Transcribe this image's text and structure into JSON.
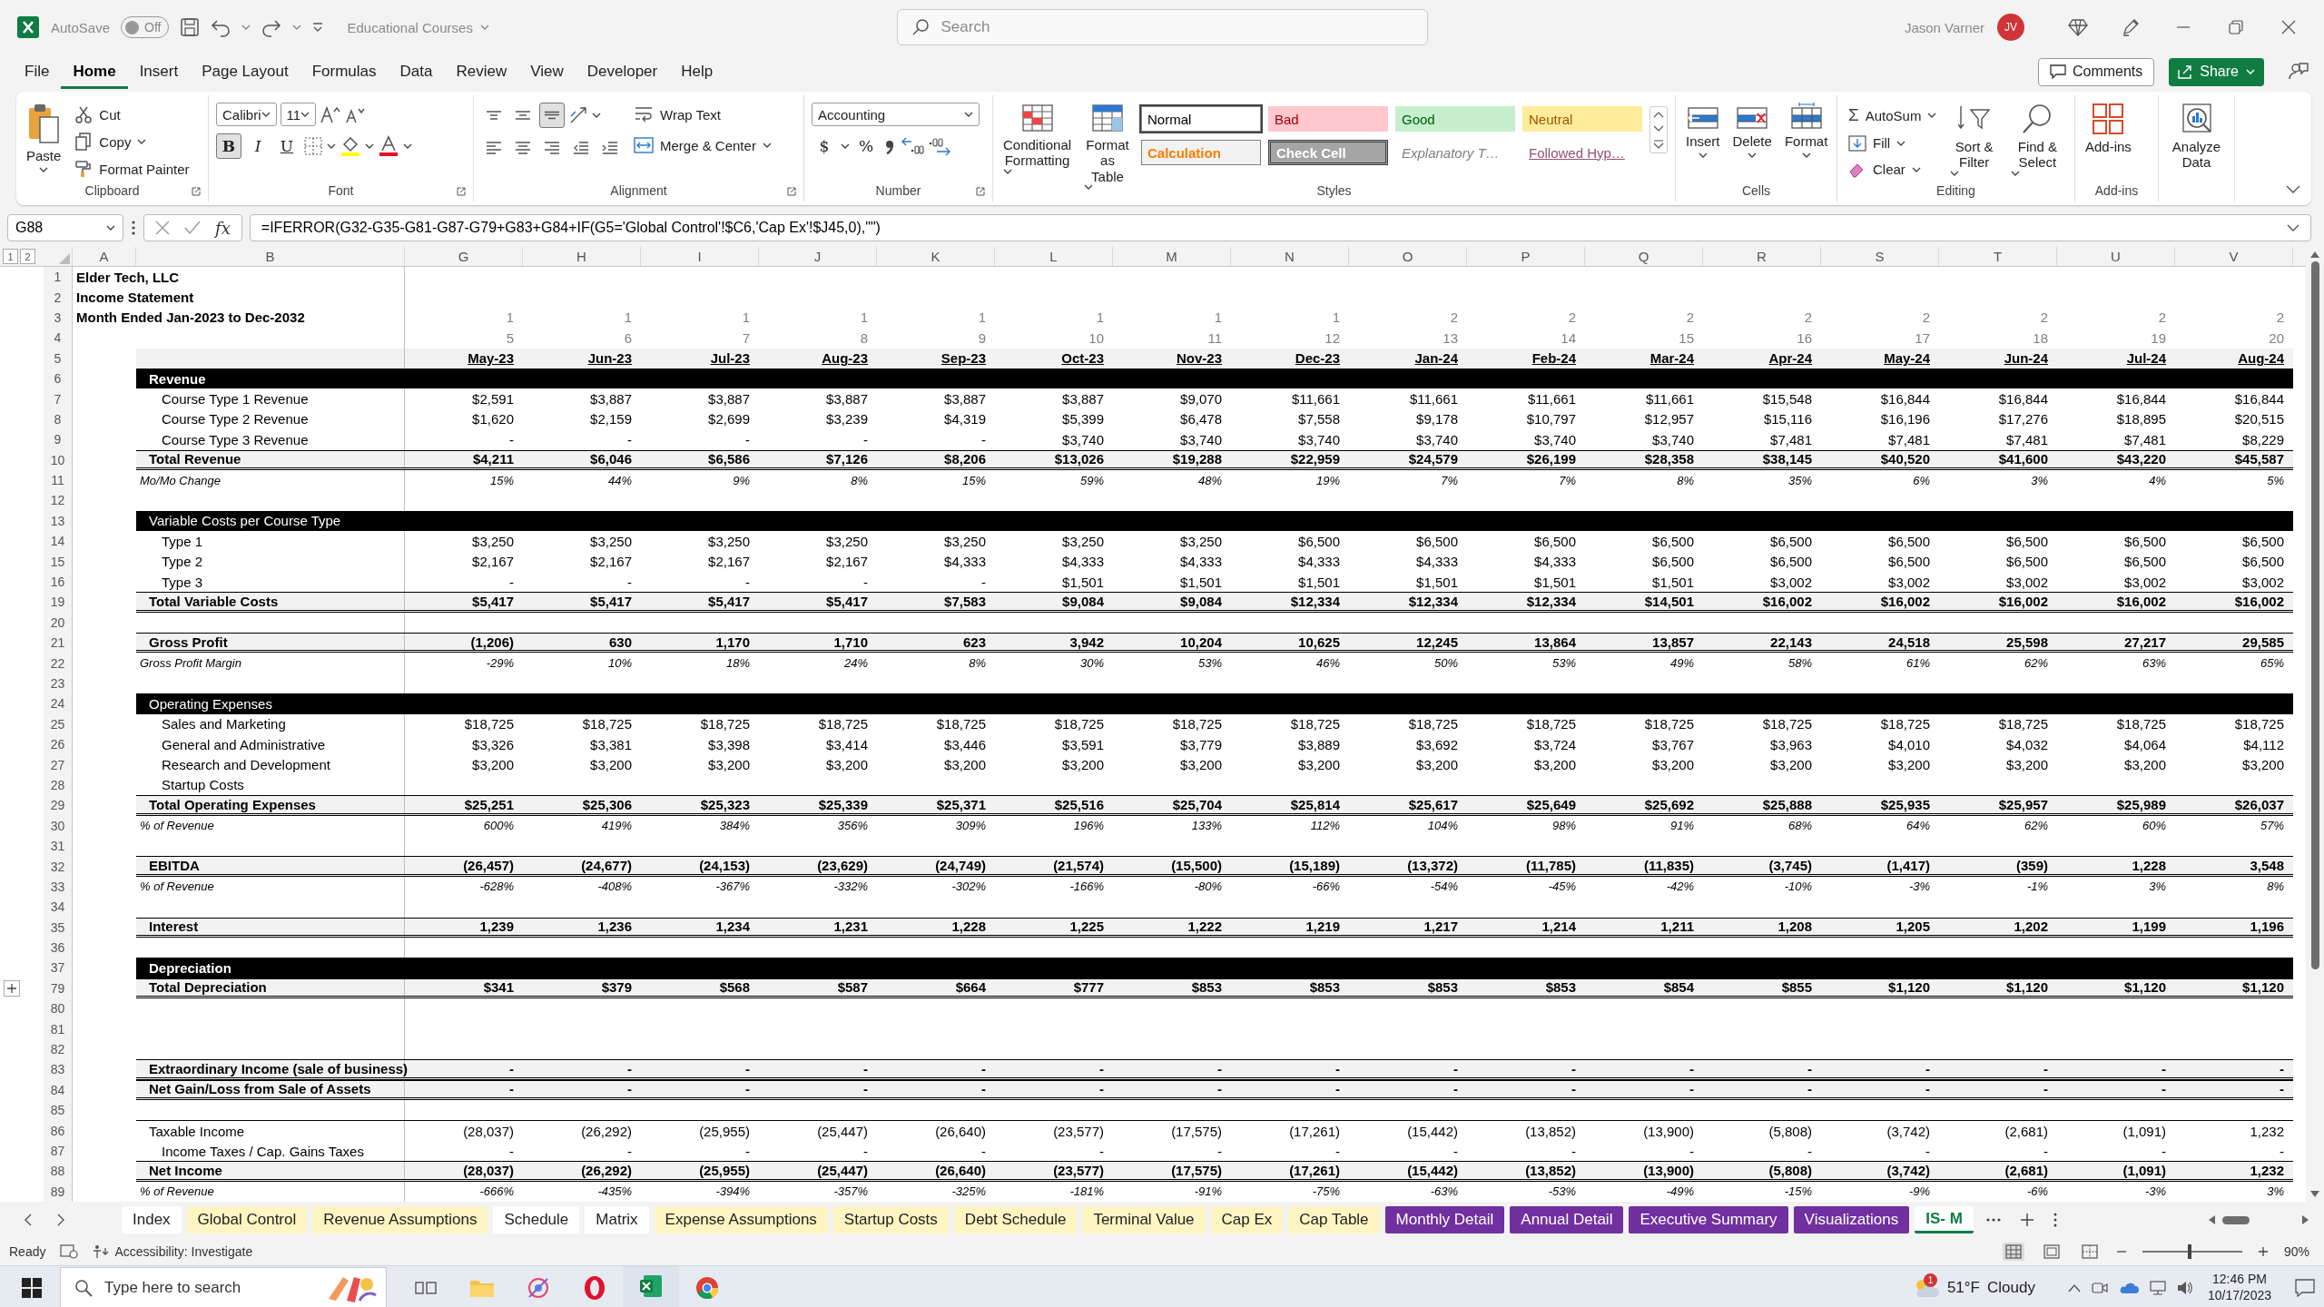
{
  "title_bar": {
    "autosave_label": "AutoSave",
    "autosave": {
      "on": false,
      "label": "Off"
    },
    "document": "Educational Courses",
    "search_placeholder": "Search",
    "user": "Jason Varner",
    "avatar": "JV"
  },
  "menu_tabs": [
    {
      "label": "File",
      "selected": false
    },
    {
      "label": "Home",
      "selected": true
    },
    {
      "label": "Insert",
      "selected": false
    },
    {
      "label": "Page Layout",
      "selected": false
    },
    {
      "label": "Formulas",
      "selected": false
    },
    {
      "label": "Data",
      "selected": false
    },
    {
      "label": "Review",
      "selected": false
    },
    {
      "label": "View",
      "selected": false
    },
    {
      "label": "Developer",
      "selected": false
    },
    {
      "label": "Help",
      "selected": false
    }
  ],
  "comments": "Comments",
  "share": "Share",
  "ribbon": {
    "clipboard": {
      "title": "Clipboard",
      "paste": "Paste",
      "cut": "Cut",
      "copy": "Copy",
      "format_painter": "Format Painter"
    },
    "font": {
      "title": "Font",
      "font": "Calibri",
      "size": "11",
      "styles": [
        {
          "label": "B",
          "selected": true
        },
        {
          "label": "I",
          "selected": false
        },
        {
          "label": "U",
          "selected": false
        }
      ]
    },
    "alignment": {
      "title": "Alignment",
      "vertical": [
        {
          "selected": false
        },
        {
          "selected": false
        },
        {
          "selected": true
        }
      ],
      "wrap": "Wrap Text",
      "merge": "Merge & Center"
    },
    "number": {
      "title": "Number",
      "format": "Accounting",
      "currency": "$",
      "percent": "%"
    },
    "styles": {
      "title": "Styles",
      "conditional": "Conditional Formatting",
      "table": "Format as Table",
      "cells": [
        {
          "label": "Normal",
          "kind": "normal",
          "selected": true
        },
        {
          "label": "Bad",
          "kind": "bad",
          "selected": false
        },
        {
          "label": "Good",
          "kind": "good",
          "selected": false
        },
        {
          "label": "Neutral",
          "kind": "neutral",
          "selected": false
        },
        {
          "label": "Calculation",
          "kind": "calculation",
          "selected": false
        },
        {
          "label": "Check Cell",
          "kind": "check",
          "selected": false
        },
        {
          "label": "Explanatory T…",
          "kind": "explanatory",
          "selected": false
        },
        {
          "label": "Followed Hyp…",
          "kind": "hyperlink",
          "selected": false
        }
      ]
    },
    "cells": {
      "title": "Cells",
      "buttons": [
        "Insert",
        "Delete",
        "Format"
      ]
    },
    "editing": {
      "title": "Editing",
      "autosum_symbol": "Σ",
      "autosum": "AutoSum",
      "fill": "Fill",
      "clear": "Clear",
      "sort": "Sort & Filter",
      "find": "Find & Select"
    },
    "addins": {
      "title": "Add-ins",
      "button": "Add-ins"
    },
    "analyze": {
      "button": "Analyze Data"
    }
  },
  "formula_bar": {
    "name_box": "G88",
    "fx": "fx",
    "formula": "=IFERROR(G32-G35-G81-G87-G79+G83+G84+IF(G5='Global Control'!$C6,'Cap Ex'!$J45,0),\"\")"
  },
  "sheet": {
    "outline_levels": [
      "1",
      "2"
    ],
    "columns": [
      "A",
      "B",
      "G",
      "H",
      "I",
      "J",
      "K",
      "L",
      "M",
      "N",
      "O",
      "P",
      "Q",
      "R",
      "S",
      "T",
      "U",
      "V"
    ],
    "rows": [
      {
        "n": "1",
        "kind": "title",
        "collapsed": false,
        "label": "Elder Tech, LLC"
      },
      {
        "n": "2",
        "kind": "title",
        "collapsed": false,
        "label": "Income Statement"
      },
      {
        "n": "3",
        "kind": "title",
        "collapsed": false,
        "label": "Month Ended Jan-2023 to Dec-2032",
        "values": [
          "1",
          "1",
          "1",
          "1",
          "1",
          "1",
          "1",
          "1",
          "2",
          "2",
          "2",
          "2",
          "2",
          "2",
          "2",
          "2"
        ]
      },
      {
        "n": "4",
        "kind": "index",
        "collapsed": false,
        "values": [
          "5",
          "6",
          "7",
          "8",
          "9",
          "10",
          "11",
          "12",
          "13",
          "14",
          "15",
          "16",
          "17",
          "18",
          "19",
          "20"
        ]
      },
      {
        "n": "5",
        "kind": "months",
        "collapsed": false,
        "values": [
          "May-23",
          "Jun-23",
          "Jul-23",
          "Aug-23",
          "Sep-23",
          "Oct-23",
          "Nov-23",
          "Dec-23",
          "Jan-24",
          "Feb-24",
          "Mar-24",
          "Apr-24",
          "May-24",
          "Jun-24",
          "Jul-24",
          "Aug-24"
        ]
      },
      {
        "n": "6",
        "kind": "section",
        "collapsed": false,
        "label": "Revenue"
      },
      {
        "n": "7",
        "kind": "item",
        "collapsed": false,
        "label": "Course Type 1 Revenue",
        "values": [
          "$2,591",
          "$3,887",
          "$3,887",
          "$3,887",
          "$3,887",
          "$3,887",
          "$9,070",
          "$11,661",
          "$11,661",
          "$11,661",
          "$11,661",
          "$15,548",
          "$16,844",
          "$16,844",
          "$16,844",
          "$16,844"
        ]
      },
      {
        "n": "8",
        "kind": "item",
        "collapsed": false,
        "label": "Course Type 2 Revenue",
        "values": [
          "$1,620",
          "$2,159",
          "$2,699",
          "$3,239",
          "$4,319",
          "$5,399",
          "$6,478",
          "$7,558",
          "$9,178",
          "$10,797",
          "$12,957",
          "$15,116",
          "$16,196",
          "$17,276",
          "$18,895",
          "$20,515"
        ]
      },
      {
        "n": "9",
        "kind": "item",
        "collapsed": false,
        "label": "Course Type 3 Revenue",
        "values": [
          "-",
          "-",
          "-",
          "-",
          "-",
          "$3,740",
          "$3,740",
          "$3,740",
          "$3,740",
          "$3,740",
          "$3,740",
          "$7,481",
          "$7,481",
          "$7,481",
          "$7,481",
          "$8,229"
        ]
      },
      {
        "n": "10",
        "kind": "total",
        "collapsed": false,
        "label": "Total Revenue",
        "values": [
          "$4,211",
          "$6,046",
          "$6,586",
          "$7,126",
          "$8,206",
          "$13,026",
          "$19,288",
          "$22,959",
          "$24,579",
          "$26,199",
          "$28,358",
          "$38,145",
          "$40,520",
          "$41,600",
          "$43,220",
          "$45,587"
        ]
      },
      {
        "n": "11",
        "kind": "ratio",
        "collapsed": false,
        "label": "Mo/Mo Change",
        "values": [
          "15%",
          "44%",
          "9%",
          "8%",
          "15%",
          "59%",
          "48%",
          "19%",
          "7%",
          "7%",
          "8%",
          "35%",
          "6%",
          "3%",
          "4%",
          "5%"
        ]
      },
      {
        "n": "12",
        "kind": "blank",
        "collapsed": false
      },
      {
        "n": "13",
        "kind": "group",
        "collapsed": false,
        "label": "Variable Costs per Course Type"
      },
      {
        "n": "14",
        "kind": "item",
        "collapsed": false,
        "label": "Type 1",
        "values": [
          "$3,250",
          "$3,250",
          "$3,250",
          "$3,250",
          "$3,250",
          "$3,250",
          "$3,250",
          "$6,500",
          "$6,500",
          "$6,500",
          "$6,500",
          "$6,500",
          "$6,500",
          "$6,500",
          "$6,500",
          "$6,500"
        ]
      },
      {
        "n": "15",
        "kind": "item",
        "collapsed": false,
        "label": "Type 2",
        "values": [
          "$2,167",
          "$2,167",
          "$2,167",
          "$2,167",
          "$4,333",
          "$4,333",
          "$4,333",
          "$4,333",
          "$4,333",
          "$4,333",
          "$6,500",
          "$6,500",
          "$6,500",
          "$6,500",
          "$6,500",
          "$6,500"
        ]
      },
      {
        "n": "16",
        "kind": "item",
        "collapsed": false,
        "label": "Type 3",
        "values": [
          "-",
          "-",
          "-",
          "-",
          "-",
          "$1,501",
          "$1,501",
          "$1,501",
          "$1,501",
          "$1,501",
          "$1,501",
          "$3,002",
          "$3,002",
          "$3,002",
          "$3,002",
          "$3,002"
        ]
      },
      {
        "n": "19",
        "kind": "total",
        "collapsed": false,
        "label": "Total Variable Costs",
        "values": [
          "$5,417",
          "$5,417",
          "$5,417",
          "$5,417",
          "$7,583",
          "$9,084",
          "$9,084",
          "$12,334",
          "$12,334",
          "$12,334",
          "$14,501",
          "$16,002",
          "$16,002",
          "$16,002",
          "$16,002",
          "$16,002"
        ]
      },
      {
        "n": "20",
        "kind": "blank",
        "collapsed": false
      },
      {
        "n": "21",
        "kind": "total",
        "collapsed": false,
        "label": "Gross Profit",
        "values": [
          "(1,206)",
          "630",
          "1,170",
          "1,710",
          "623",
          "3,942",
          "10,204",
          "10,625",
          "12,245",
          "13,864",
          "13,857",
          "22,143",
          "24,518",
          "25,598",
          "27,217",
          "29,585"
        ]
      },
      {
        "n": "22",
        "kind": "ratio",
        "collapsed": false,
        "label": "Gross Profit Margin",
        "values": [
          "-29%",
          "10%",
          "18%",
          "24%",
          "8%",
          "30%",
          "53%",
          "46%",
          "50%",
          "53%",
          "49%",
          "58%",
          "61%",
          "62%",
          "63%",
          "65%"
        ]
      },
      {
        "n": "23",
        "kind": "blank",
        "collapsed": false
      },
      {
        "n": "24",
        "kind": "group",
        "collapsed": false,
        "label": "Operating Expenses"
      },
      {
        "n": "25",
        "kind": "item",
        "collapsed": false,
        "label": "Sales and Marketing",
        "values": [
          "$18,725",
          "$18,725",
          "$18,725",
          "$18,725",
          "$18,725",
          "$18,725",
          "$18,725",
          "$18,725",
          "$18,725",
          "$18,725",
          "$18,725",
          "$18,725",
          "$18,725",
          "$18,725",
          "$18,725",
          "$18,725"
        ]
      },
      {
        "n": "26",
        "kind": "item",
        "collapsed": false,
        "label": "General and Administrative",
        "values": [
          "$3,326",
          "$3,381",
          "$3,398",
          "$3,414",
          "$3,446",
          "$3,591",
          "$3,779",
          "$3,889",
          "$3,692",
          "$3,724",
          "$3,767",
          "$3,963",
          "$4,010",
          "$4,032",
          "$4,064",
          "$4,112"
        ]
      },
      {
        "n": "27",
        "kind": "item",
        "collapsed": false,
        "label": "Research and Development",
        "values": [
          "$3,200",
          "$3,200",
          "$3,200",
          "$3,200",
          "$3,200",
          "$3,200",
          "$3,200",
          "$3,200",
          "$3,200",
          "$3,200",
          "$3,200",
          "$3,200",
          "$3,200",
          "$3,200",
          "$3,200",
          "$3,200"
        ]
      },
      {
        "n": "28",
        "kind": "item",
        "collapsed": false,
        "label": "Startup Costs"
      },
      {
        "n": "29",
        "kind": "total",
        "collapsed": false,
        "label": "Total Operating Expenses",
        "values": [
          "$25,251",
          "$25,306",
          "$25,323",
          "$25,339",
          "$25,371",
          "$25,516",
          "$25,704",
          "$25,814",
          "$25,617",
          "$25,649",
          "$25,692",
          "$25,888",
          "$25,935",
          "$25,957",
          "$25,989",
          "$26,037"
        ]
      },
      {
        "n": "30",
        "kind": "ratio",
        "collapsed": false,
        "label": "% of Revenue",
        "values": [
          "600%",
          "419%",
          "384%",
          "356%",
          "309%",
          "196%",
          "133%",
          "112%",
          "104%",
          "98%",
          "91%",
          "68%",
          "64%",
          "62%",
          "60%",
          "57%"
        ]
      },
      {
        "n": "31",
        "kind": "blank",
        "collapsed": false
      },
      {
        "n": "32",
        "kind": "total",
        "collapsed": false,
        "label": "EBITDA",
        "values": [
          "(26,457)",
          "(24,677)",
          "(24,153)",
          "(23,629)",
          "(24,749)",
          "(21,574)",
          "(15,500)",
          "(15,189)",
          "(13,372)",
          "(11,785)",
          "(11,835)",
          "(3,745)",
          "(1,417)",
          "(359)",
          "1,228",
          "3,548"
        ]
      },
      {
        "n": "33",
        "kind": "ratio",
        "collapsed": false,
        "label": "% of Revenue",
        "values": [
          "-628%",
          "-408%",
          "-367%",
          "-332%",
          "-302%",
          "-166%",
          "-80%",
          "-66%",
          "-54%",
          "-45%",
          "-42%",
          "-10%",
          "-3%",
          "-1%",
          "3%",
          "8%"
        ]
      },
      {
        "n": "34",
        "kind": "blank",
        "collapsed": false
      },
      {
        "n": "35",
        "kind": "total",
        "collapsed": false,
        "label": "Interest",
        "values": [
          "1,239",
          "1,236",
          "1,234",
          "1,231",
          "1,228",
          "1,225",
          "1,222",
          "1,219",
          "1,217",
          "1,214",
          "1,211",
          "1,208",
          "1,205",
          "1,202",
          "1,199",
          "1,196"
        ]
      },
      {
        "n": "36",
        "kind": "blank",
        "collapsed": false
      },
      {
        "n": "37",
        "kind": "section",
        "collapsed": false,
        "label": "Depreciation"
      },
      {
        "n": "79",
        "kind": "total",
        "collapsed": true,
        "label": "Total Depreciation",
        "values": [
          "$341",
          "$379",
          "$568",
          "$587",
          "$664",
          "$777",
          "$853",
          "$853",
          "$853",
          "$853",
          "$854",
          "$855",
          "$1,120",
          "$1,120",
          "$1,120",
          "$1,120"
        ]
      },
      {
        "n": "80",
        "kind": "blank",
        "collapsed": false
      },
      {
        "n": "81",
        "kind": "blank",
        "collapsed": false
      },
      {
        "n": "82",
        "kind": "blank",
        "collapsed": false
      },
      {
        "n": "83",
        "kind": "total",
        "collapsed": false,
        "label": "Extraordinary Income (sale of business)",
        "values": [
          "-",
          "-",
          "-",
          "-",
          "-",
          "-",
          "-",
          "-",
          "-",
          "-",
          "-",
          "-",
          "-",
          "-",
          "-",
          "-"
        ]
      },
      {
        "n": "84",
        "kind": "total",
        "collapsed": false,
        "label": "Net Gain/Loss from Sale of Assets",
        "values": [
          "-",
          "-",
          "-",
          "-",
          "-",
          "-",
          "-",
          "-",
          "-",
          "-",
          "-",
          "-",
          "-",
          "-",
          "-",
          "-"
        ]
      },
      {
        "n": "85",
        "kind": "blank",
        "collapsed": false
      },
      {
        "n": "86",
        "kind": "line",
        "collapsed": false,
        "label": "Taxable Income",
        "values": [
          "(28,037)",
          "(26,292)",
          "(25,955)",
          "(25,447)",
          "(26,640)",
          "(23,577)",
          "(17,575)",
          "(17,261)",
          "(15,442)",
          "(13,852)",
          "(13,900)",
          "(5,808)",
          "(3,742)",
          "(2,681)",
          "(1,091)",
          "1,232"
        ]
      },
      {
        "n": "87",
        "kind": "item",
        "collapsed": false,
        "label": "Income Taxes / Cap. Gains Taxes",
        "values": [
          "-",
          "-",
          "-",
          "-",
          "-",
          "-",
          "-",
          "-",
          "-",
          "-",
          "-",
          "-",
          "-",
          "-",
          "-",
          "-"
        ]
      },
      {
        "n": "88",
        "kind": "total",
        "collapsed": false,
        "label": "Net Income",
        "values": [
          "(28,037)",
          "(26,292)",
          "(25,955)",
          "(25,447)",
          "(26,640)",
          "(23,577)",
          "(17,575)",
          "(17,261)",
          "(15,442)",
          "(13,852)",
          "(13,900)",
          "(5,808)",
          "(3,742)",
          "(2,681)",
          "(1,091)",
          "1,232"
        ]
      },
      {
        "n": "89",
        "kind": "ratio",
        "collapsed": false,
        "label": "% of Revenue",
        "values": [
          "-666%",
          "-435%",
          "-394%",
          "-357%",
          "-325%",
          "-181%",
          "-91%",
          "-75%",
          "-63%",
          "-53%",
          "-49%",
          "-15%",
          "-9%",
          "-6%",
          "-3%",
          "3%"
        ]
      }
    ]
  },
  "sheet_tabs": [
    {
      "label": "Index",
      "color": "#ffffff",
      "selected": false
    },
    {
      "label": "Global Control",
      "color": "#fff5c2",
      "selected": false
    },
    {
      "label": "Revenue Assumptions",
      "color": "#fff5c2",
      "selected": false
    },
    {
      "label": "Schedule",
      "color": "#ffffff",
      "selected": false
    },
    {
      "label": "Matrix",
      "color": "#ffffff",
      "selected": false
    },
    {
      "label": "Expense Assumptions",
      "color": "#fff5c2",
      "selected": false
    },
    {
      "label": "Startup Costs",
      "color": "#fff5c2",
      "selected": false
    },
    {
      "label": "Debt Schedule",
      "color": "#fff5c2",
      "selected": false
    },
    {
      "label": "Terminal Value",
      "color": "#fff5c2",
      "selected": false
    },
    {
      "label": "Cap Ex",
      "color": "#fff5c2",
      "selected": false
    },
    {
      "label": "Cap Table",
      "color": "#fff5c2",
      "selected": false
    },
    {
      "label": "Monthly Detail",
      "color": "#7030a0",
      "selected": false
    },
    {
      "label": "Annual Detail",
      "color": "#7030a0",
      "selected": false
    },
    {
      "label": "Executive Summary",
      "color": "#7030a0",
      "selected": false
    },
    {
      "label": "Visualizations",
      "color": "#7030a0",
      "selected": false
    },
    {
      "label": "IS- M",
      "color": "#ffffff",
      "selected": true
    }
  ],
  "status_bar": {
    "ready": "Ready",
    "accessibility": "Accessibility: Investigate",
    "views": [
      {
        "selected": true
      },
      {
        "selected": false
      },
      {
        "selected": false
      }
    ],
    "zoom_slider": {
      "level": 0.47
    },
    "zoom": "90%"
  },
  "taskbar": {
    "search_placeholder": "Type here to search",
    "weather_badge": "1",
    "temperature": "51°F",
    "weather": "Cloudy",
    "time": "12:46 PM",
    "date": "10/17/2023"
  }
}
